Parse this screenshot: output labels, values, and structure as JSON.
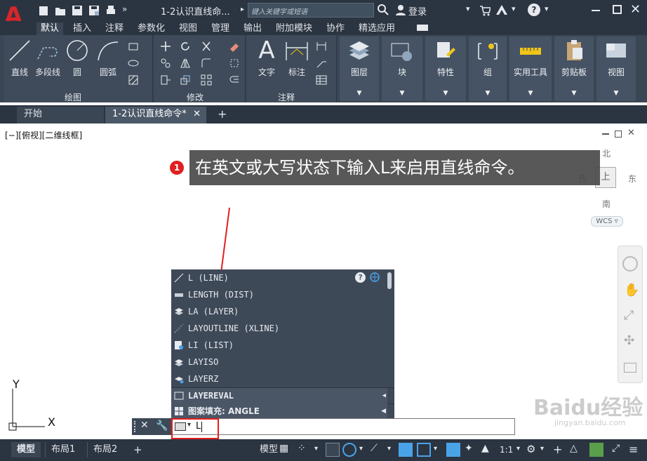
{
  "title_bar": {
    "app_logo": "A",
    "doc_title": "1-2认识直线命...",
    "search_placeholder": "键入关键字或短语",
    "login": "登录",
    "icons": [
      "new-icon",
      "open-icon",
      "save-icon",
      "saveas-icon",
      "print-icon",
      "more-icon",
      "search-icon",
      "user-icon",
      "cart-icon",
      "autodesk-icon",
      "help-icon",
      "minimize-icon",
      "maximize-icon",
      "close-icon"
    ]
  },
  "ribbon_tabs": [
    "默认",
    "插入",
    "注释",
    "参数化",
    "视图",
    "管理",
    "输出",
    "附加模块",
    "协作",
    "精选应用"
  ],
  "ribbon": {
    "draw": {
      "label": "绘图",
      "line": "直线",
      "polyline": "多段线",
      "circle": "圆",
      "arc": "圆弧"
    },
    "modify": {
      "label": "修改"
    },
    "annotation": {
      "label": "注释",
      "text": "文字",
      "dimension": "标注"
    },
    "layers": "图层",
    "block": "块",
    "properties": "特性",
    "group": "组",
    "utilities": "实用工具",
    "clipboard": "剪贴板",
    "view": "视图"
  },
  "doc_tabs": {
    "start": "开始",
    "current": "1-2认识直线命令*"
  },
  "viewport": {
    "label": "[−][俯视][二维线框]",
    "viewcube": {
      "north": "北",
      "south": "南",
      "east": "东",
      "west": "西",
      "top": "上",
      "wcs": "WCS"
    },
    "ucs_x": "X",
    "ucs_y": "Y"
  },
  "callout": {
    "number": "1",
    "text": "在英文或大写状态下输入L来启用直线命令。"
  },
  "autocomplete": {
    "items": [
      {
        "text": "L (LINE)",
        "icon": "line-icon"
      },
      {
        "text": "LENGTH (DIST)",
        "icon": "ruler-icon"
      },
      {
        "text": "LA (LAYER)",
        "icon": "layer-icon"
      },
      {
        "text": "LAYOUTLINE (XLINE)",
        "icon": "xline-icon"
      },
      {
        "text": "LI (LIST)",
        "icon": "list-icon"
      },
      {
        "text": "LAYISO",
        "icon": "layiso-icon"
      },
      {
        "text": "LAYERZ",
        "icon": "layerz-icon"
      }
    ],
    "sections": [
      {
        "text": "LAYEREVAL",
        "icon": "layereval-icon"
      },
      {
        "text": "图案填充: ANGLE",
        "icon": "hatch-icon"
      }
    ]
  },
  "command_line": {
    "value": "L"
  },
  "status_bar": {
    "tabs": [
      "模型",
      "布局1",
      "布局2"
    ],
    "model_label": "模型",
    "scale": "1:1"
  },
  "watermark": {
    "text": "Baidu经验",
    "url": "jingyan.baidu.com"
  },
  "colors": {
    "titlebar": "#2b3441",
    "ribbon": "#3b4654",
    "accent_red": "#d7262a",
    "callout_bg": "#4a4a4a"
  }
}
